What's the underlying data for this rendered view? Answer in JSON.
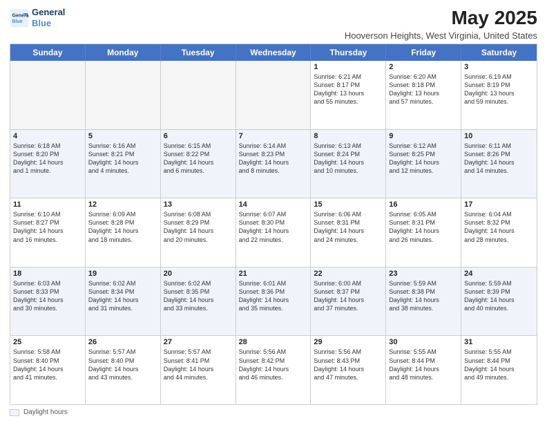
{
  "logo": {
    "line1": "General",
    "line2": "Blue"
  },
  "title": "May 2025",
  "subtitle": "Hooverson Heights, West Virginia, United States",
  "legend_label": "Daylight hours",
  "headers": [
    "Sunday",
    "Monday",
    "Tuesday",
    "Wednesday",
    "Thursday",
    "Friday",
    "Saturday"
  ],
  "weeks": [
    [
      {
        "day": "",
        "info": ""
      },
      {
        "day": "",
        "info": ""
      },
      {
        "day": "",
        "info": ""
      },
      {
        "day": "",
        "info": ""
      },
      {
        "day": "1",
        "info": "Sunrise: 6:21 AM\nSunset: 8:17 PM\nDaylight: 13 hours\nand 55 minutes."
      },
      {
        "day": "2",
        "info": "Sunrise: 6:20 AM\nSunset: 8:18 PM\nDaylight: 13 hours\nand 57 minutes."
      },
      {
        "day": "3",
        "info": "Sunrise: 6:19 AM\nSunset: 8:19 PM\nDaylight: 13 hours\nand 59 minutes."
      }
    ],
    [
      {
        "day": "4",
        "info": "Sunrise: 6:18 AM\nSunset: 8:20 PM\nDaylight: 14 hours\nand 1 minute."
      },
      {
        "day": "5",
        "info": "Sunrise: 6:16 AM\nSunset: 8:21 PM\nDaylight: 14 hours\nand 4 minutes."
      },
      {
        "day": "6",
        "info": "Sunrise: 6:15 AM\nSunset: 8:22 PM\nDaylight: 14 hours\nand 6 minutes."
      },
      {
        "day": "7",
        "info": "Sunrise: 6:14 AM\nSunset: 8:23 PM\nDaylight: 14 hours\nand 8 minutes."
      },
      {
        "day": "8",
        "info": "Sunrise: 6:13 AM\nSunset: 8:24 PM\nDaylight: 14 hours\nand 10 minutes."
      },
      {
        "day": "9",
        "info": "Sunrise: 6:12 AM\nSunset: 8:25 PM\nDaylight: 14 hours\nand 12 minutes."
      },
      {
        "day": "10",
        "info": "Sunrise: 6:11 AM\nSunset: 8:26 PM\nDaylight: 14 hours\nand 14 minutes."
      }
    ],
    [
      {
        "day": "11",
        "info": "Sunrise: 6:10 AM\nSunset: 8:27 PM\nDaylight: 14 hours\nand 16 minutes."
      },
      {
        "day": "12",
        "info": "Sunrise: 6:09 AM\nSunset: 8:28 PM\nDaylight: 14 hours\nand 18 minutes."
      },
      {
        "day": "13",
        "info": "Sunrise: 6:08 AM\nSunset: 8:29 PM\nDaylight: 14 hours\nand 20 minutes."
      },
      {
        "day": "14",
        "info": "Sunrise: 6:07 AM\nSunset: 8:30 PM\nDaylight: 14 hours\nand 22 minutes."
      },
      {
        "day": "15",
        "info": "Sunrise: 6:06 AM\nSunset: 8:31 PM\nDaylight: 14 hours\nand 24 minutes."
      },
      {
        "day": "16",
        "info": "Sunrise: 6:05 AM\nSunset: 8:31 PM\nDaylight: 14 hours\nand 26 minutes."
      },
      {
        "day": "17",
        "info": "Sunrise: 6:04 AM\nSunset: 8:32 PM\nDaylight: 14 hours\nand 28 minutes."
      }
    ],
    [
      {
        "day": "18",
        "info": "Sunrise: 6:03 AM\nSunset: 8:33 PM\nDaylight: 14 hours\nand 30 minutes."
      },
      {
        "day": "19",
        "info": "Sunrise: 6:02 AM\nSunset: 8:34 PM\nDaylight: 14 hours\nand 31 minutes."
      },
      {
        "day": "20",
        "info": "Sunrise: 6:02 AM\nSunset: 8:35 PM\nDaylight: 14 hours\nand 33 minutes."
      },
      {
        "day": "21",
        "info": "Sunrise: 6:01 AM\nSunset: 8:36 PM\nDaylight: 14 hours\nand 35 minutes."
      },
      {
        "day": "22",
        "info": "Sunrise: 6:00 AM\nSunset: 8:37 PM\nDaylight: 14 hours\nand 37 minutes."
      },
      {
        "day": "23",
        "info": "Sunrise: 5:59 AM\nSunset: 8:38 PM\nDaylight: 14 hours\nand 38 minutes."
      },
      {
        "day": "24",
        "info": "Sunrise: 5:59 AM\nSunset: 8:39 PM\nDaylight: 14 hours\nand 40 minutes."
      }
    ],
    [
      {
        "day": "25",
        "info": "Sunrise: 5:58 AM\nSunset: 8:40 PM\nDaylight: 14 hours\nand 41 minutes."
      },
      {
        "day": "26",
        "info": "Sunrise: 5:57 AM\nSunset: 8:40 PM\nDaylight: 14 hours\nand 43 minutes."
      },
      {
        "day": "27",
        "info": "Sunrise: 5:57 AM\nSunset: 8:41 PM\nDaylight: 14 hours\nand 44 minutes."
      },
      {
        "day": "28",
        "info": "Sunrise: 5:56 AM\nSunset: 8:42 PM\nDaylight: 14 hours\nand 46 minutes."
      },
      {
        "day": "29",
        "info": "Sunrise: 5:56 AM\nSunset: 8:43 PM\nDaylight: 14 hours\nand 47 minutes."
      },
      {
        "day": "30",
        "info": "Sunrise: 5:55 AM\nSunset: 8:44 PM\nDaylight: 14 hours\nand 48 minutes."
      },
      {
        "day": "31",
        "info": "Sunrise: 5:55 AM\nSunset: 8:44 PM\nDaylight: 14 hours\nand 49 minutes."
      }
    ]
  ]
}
